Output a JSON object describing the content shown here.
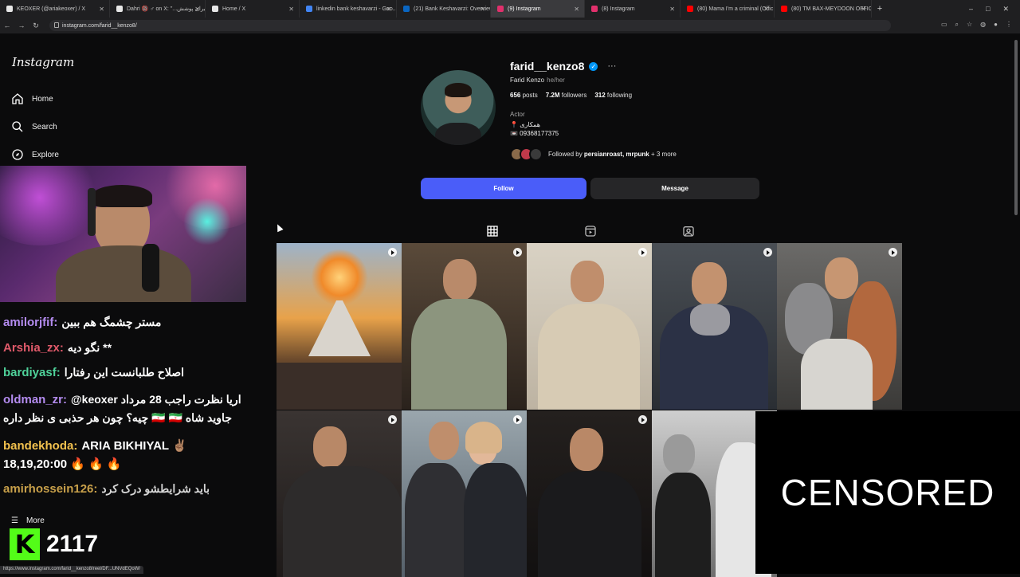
{
  "browser": {
    "tabs": [
      {
        "title": "KEOXER (@ariakeoxer) / X",
        "color": "#e7e7e7",
        "active": false
      },
      {
        "title": "Dahri 🔞 ♂ on X: \"...برای پوشش",
        "color": "#e7e7e7",
        "active": false
      },
      {
        "title": "Home / X",
        "color": "#e7e7e7",
        "active": false
      },
      {
        "title": "linkedin bank keshavarzi - Goo...",
        "color": "#4285f4",
        "active": false
      },
      {
        "title": "(21) Bank Keshavarzi: Overview",
        "color": "#0a66c2",
        "active": false
      },
      {
        "title": "(9) Instagram",
        "color": "#e1306c",
        "active": true
      },
      {
        "title": "(8) Instagram",
        "color": "#e1306c",
        "active": false
      },
      {
        "title": "(80) Mama I'm a criminal (Offic...",
        "color": "#ff0000",
        "active": false
      },
      {
        "title": "(80) TM BAX-MEYDOON OFFICI...",
        "color": "#ff0000",
        "active": false
      }
    ],
    "url": "instagram.com/farid__kenzo8/",
    "status_url": "https://www.instagram.com/farid__kenzo8/reel/DF...UNVdEQoW/"
  },
  "sidebar": {
    "logo": "Instagram",
    "items": [
      {
        "label": "Home",
        "icon": "home-icon"
      },
      {
        "label": "Search",
        "icon": "search-icon"
      },
      {
        "label": "Explore",
        "icon": "compass-icon"
      }
    ],
    "more_label": "More"
  },
  "chat": [
    {
      "user": "amilorjfif:",
      "text": "مستر چشمگ هم ببین",
      "color": "#b48cf0"
    },
    {
      "user": "Arshia_zx:",
      "text": "نگو دیه **",
      "color": "#e05a6a"
    },
    {
      "user": "bardiyasf:",
      "text": "اصلاح طلبانست این رفتارا",
      "color": "#4fd29a"
    },
    {
      "user": "oldman_zr:",
      "text": "@keoxer اریا نظرت راجب 28 مرداد",
      "color": "#b48cf0"
    },
    {
      "user": "",
      "text": "چیه؟ چون هر حذبی ی نظر داره 🇮🇷 🇮🇷 جاوید شاه",
      "color": "#b48cf0"
    },
    {
      "user": "bandekhoda:",
      "text": "ARIA BIKHIYAL ✌🏽",
      "color": "#f2c14e"
    },
    {
      "user": "",
      "text": "18,19,20:00 🔥 🔥 🔥",
      "color": "#f2c14e"
    },
    {
      "user": "amirhossein126:",
      "text": "باید شرایطشو درک کرد",
      "color": "#c8a04a"
    }
  ],
  "stream": {
    "viewer_count": "2117",
    "kick_letter": "K"
  },
  "profile": {
    "username": "farid__kenzo8",
    "full_name": "Farid Kenzo",
    "pronouns": "he/her",
    "posts": "656",
    "posts_label": "posts",
    "followers": "7.2M",
    "followers_label": "followers",
    "following": "312",
    "following_label": "following",
    "category": "Actor",
    "bio_line1": "📍 همکاری",
    "bio_line2": "📼 09368177375",
    "followed_by_prefix": "Followed by",
    "followed_by_names": "persianroast, mrpunk",
    "followed_by_suffix": "+ 3 more",
    "follow_label": "Follow",
    "message_label": "Message"
  },
  "overlay": {
    "censored_label": "CENSORED"
  },
  "colors": {
    "accent": "#4a5df9",
    "verified": "#0095f6",
    "kick": "#53fc18"
  }
}
